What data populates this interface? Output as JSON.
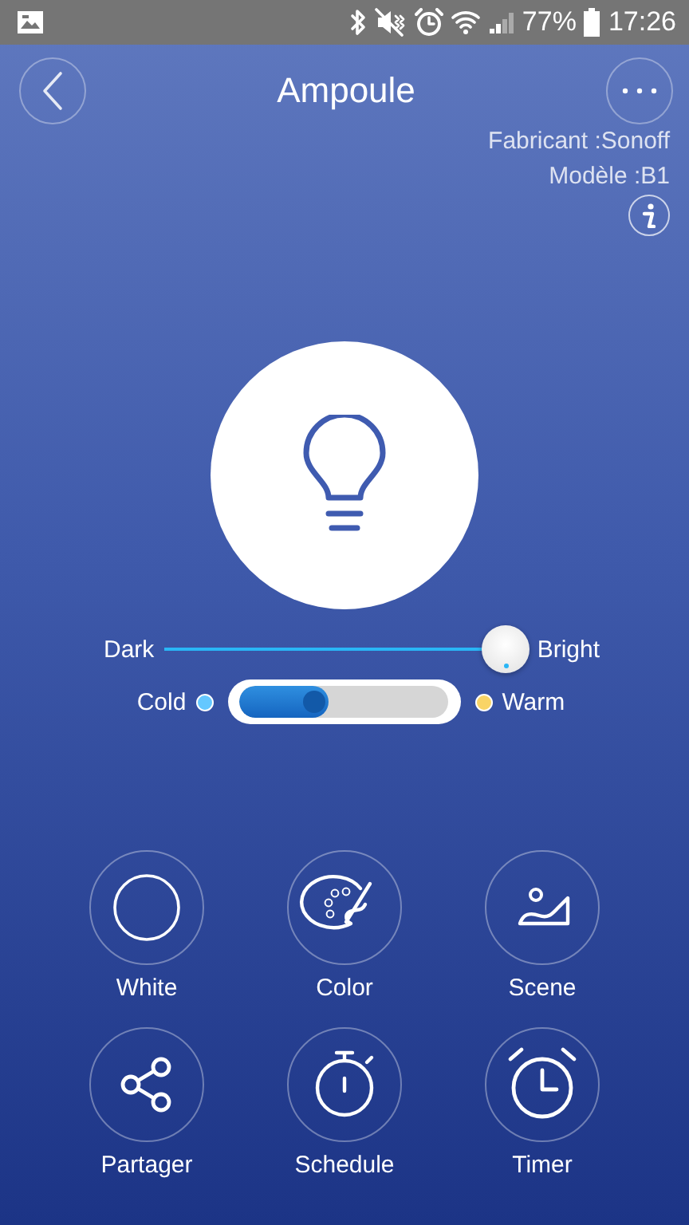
{
  "status_bar": {
    "battery": "77%",
    "time": "17:26"
  },
  "header": {
    "title": "Ampoule",
    "manufacturer": "Fabricant :Sonoff",
    "model": "Modèle :B1"
  },
  "brightness": {
    "min_label": "Dark",
    "max_label": "Bright",
    "level": 0.94
  },
  "color_temperature": {
    "cold_label": "Cold",
    "warm_label": "Warm",
    "level": 0.43
  },
  "actions": [
    {
      "kind": "white",
      "label": "White"
    },
    {
      "kind": "color",
      "label": "Color"
    },
    {
      "kind": "scene",
      "label": "Scene"
    },
    {
      "kind": "share",
      "label": "Partager"
    },
    {
      "kind": "schedule",
      "label": "Schedule"
    },
    {
      "kind": "timer",
      "label": "Timer"
    }
  ]
}
